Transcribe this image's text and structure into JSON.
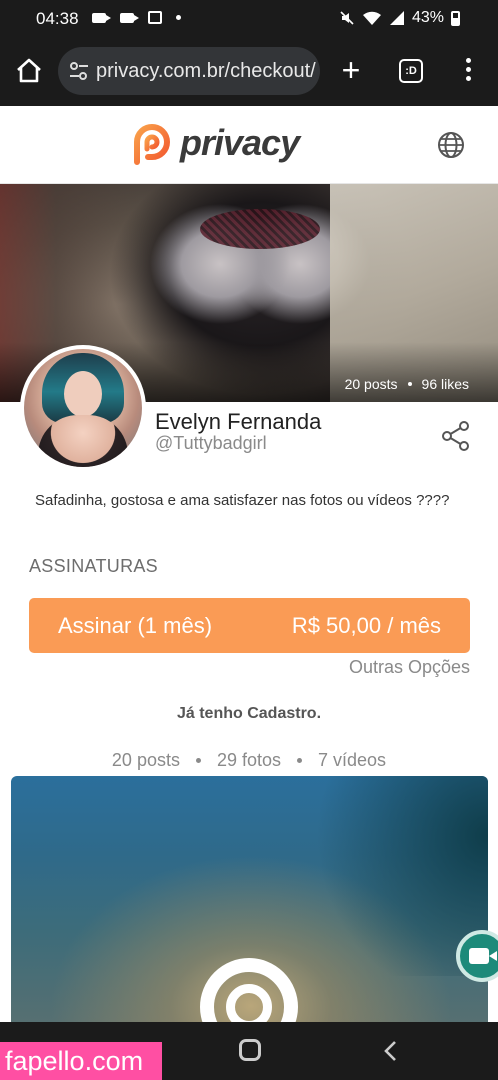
{
  "status_bar": {
    "time": "04:38",
    "battery": "43%"
  },
  "browser": {
    "url": "privacy.com.br/checkout/",
    "tabs_label": ":D"
  },
  "header": {
    "brand": "privacy"
  },
  "cover": {
    "posts": "20 posts",
    "likes": "96 likes"
  },
  "profile": {
    "name": "Evelyn Fernanda",
    "handle": "@Tuttybadgirl",
    "bio": "Safadinha, gostosa e ama satisfazer nas fotos ou vídeos ????"
  },
  "subscriptions": {
    "title": "ASSINATURAS",
    "plan_label": "Assinar (1 mês)",
    "plan_price": "R$ 50,00 / mês",
    "other_options": "Outras Opções"
  },
  "login_link": "Já tenho Cadastro.",
  "counts": {
    "posts": "20 posts",
    "photos": "29 fotos",
    "videos": "7 vídeos"
  },
  "watermark": "fapello.com",
  "colors": {
    "accent": "#fa9b55",
    "watermark": "#ff4fa3",
    "fab": "#1d8a7a"
  }
}
